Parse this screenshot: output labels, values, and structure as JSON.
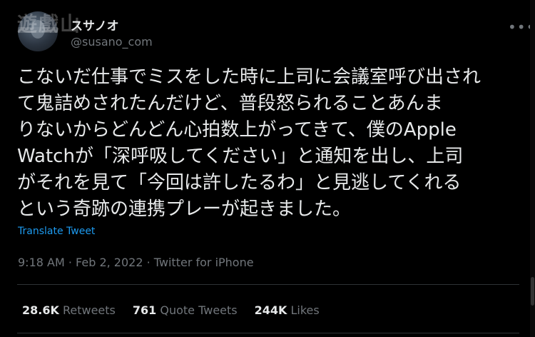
{
  "author": {
    "display_name": "スサノオ",
    "handle": "@susano_com"
  },
  "watermark": "遊戲山",
  "tweet": {
    "text": "こないだ仕事でミスをした時に上司に会議室呼び出され\nて鬼詰めされたんだけど、普段怒られることあんま\nりないからどんどん心拍数上がってきて、僕のApple\nWatchが「深呼吸してください」と通知を出し、上司\nがそれを見て「今回は許したるわ」と見逃してくれる\nという奇跡の連携プレーが起きました。",
    "translate_label": "Translate Tweet",
    "meta": "9:18 AM · Feb 2, 2022 · Twitter for iPhone"
  },
  "stats": {
    "retweets_count": "28.6K",
    "retweets_label": "Retweets",
    "quotes_count": "761",
    "quotes_label": "Quote Tweets",
    "likes_count": "244K",
    "likes_label": "Likes"
  },
  "icons": {
    "more": "more-horizontal-icon"
  },
  "colors": {
    "background": "#000000",
    "text": "#e7e9ea",
    "secondary": "#71767b",
    "link": "#1d9bf0"
  }
}
